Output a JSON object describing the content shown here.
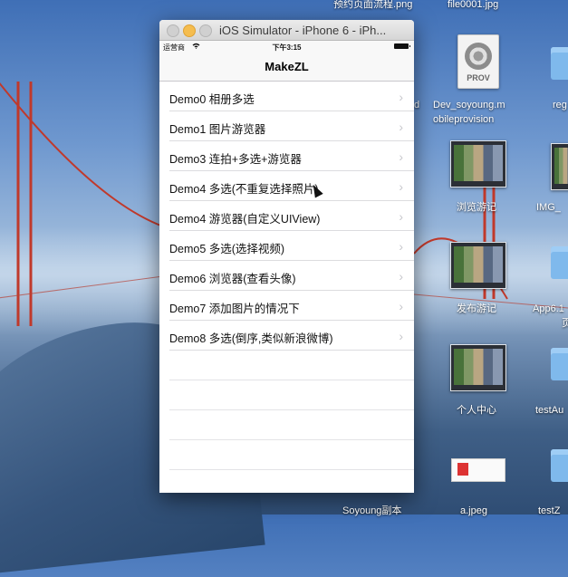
{
  "desktop": {
    "files": [
      {
        "id": "file-top-1",
        "label": "预约页面流程.png"
      },
      {
        "id": "file-top-2",
        "label": "file0001.jpg"
      },
      {
        "id": "file-prov",
        "label": "Dev_soyoung.mobileprovision",
        "label_line1": "Dev_soyoung.m",
        "label_line2": "obileprovision",
        "badge": "PROV"
      },
      {
        "id": "file-reg",
        "label": "reg"
      },
      {
        "id": "file-d",
        "label": "d"
      },
      {
        "id": "file-browse",
        "label": "浏览游记"
      },
      {
        "id": "file-img",
        "label": "IMG_"
      },
      {
        "id": "file-publish",
        "label": "发布游记"
      },
      {
        "id": "file-app6",
        "label": "App6.1",
        "label_line2": "页"
      },
      {
        "id": "file-profile",
        "label": "个人中心"
      },
      {
        "id": "file-testau",
        "label": "testAu"
      },
      {
        "id": "file-ajpeg",
        "label": "a.jpeg"
      },
      {
        "id": "file-testz",
        "label": "testZ"
      },
      {
        "id": "file-soyoung",
        "label": "Soyoung副本"
      }
    ]
  },
  "simulator": {
    "window_title": "iOS Simulator - iPhone 6 - iPh...",
    "status_bar": {
      "carrier": "运营商",
      "wifi_icon": "wifi-icon",
      "time": "下午3:15",
      "battery_icon": "battery-icon"
    },
    "nav_title": "MakeZL",
    "rows": [
      {
        "label": "Demo0 相册多选"
      },
      {
        "label": "Demo1 图片游览器"
      },
      {
        "label": "Demo3 连拍+多选+游览器"
      },
      {
        "label": "Demo4 多选(不重复选择照片)"
      },
      {
        "label": "Demo4 游览器(自定义UIView)"
      },
      {
        "label": "Demo5 多选(选择视频)"
      },
      {
        "label": "Demo6 浏览器(查看头像)"
      },
      {
        "label": "Demo7 添加图片的情况下"
      },
      {
        "label": "Demo8 多选(倒序,类似新浪微博)"
      }
    ],
    "chevron": "›"
  },
  "colors": {
    "traffic_minimize": "#f5bd4f",
    "chevron": "#c7c7cc",
    "separator": "#dcdcdf"
  }
}
